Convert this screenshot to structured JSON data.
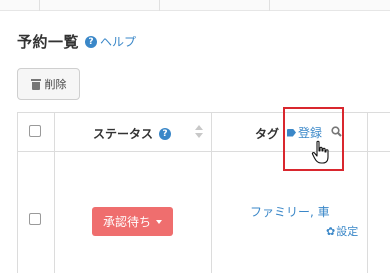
{
  "page": {
    "title": "予約一覧",
    "help_label": "ヘルプ"
  },
  "toolbar": {
    "delete_label": "削除"
  },
  "table": {
    "columns": {
      "status": "ステータス",
      "tag": "タグ",
      "register_label": "登録"
    },
    "rows": [
      {
        "status": "承認待ち",
        "tags": "ファミリー, 車",
        "settings_label": "設定"
      }
    ]
  },
  "colors": {
    "accent": "#3a87c8",
    "status_pending": "#ef6e6e",
    "highlight_box": "#d9272e"
  },
  "icons": [
    "help-icon",
    "trash-icon",
    "tag-icon",
    "search-icon",
    "gear-icon",
    "hand-cursor-icon"
  ]
}
